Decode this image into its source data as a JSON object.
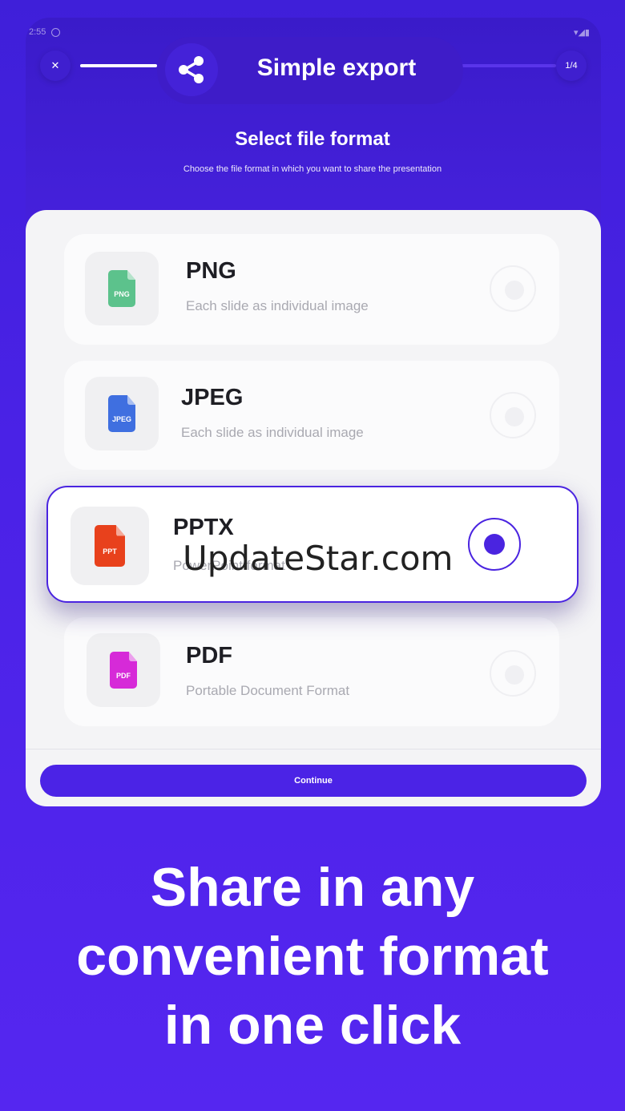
{
  "status_bar": {
    "time": "2:55"
  },
  "header": {
    "title": "Simple export",
    "step": "1/4",
    "close_symbol": "✕"
  },
  "section": {
    "title": "Select file format",
    "subtitle": "Choose the file format in which you want to share the presentation"
  },
  "options": [
    {
      "name": "PNG",
      "description": "Each slide as individual image",
      "icon_label": "PNG",
      "color": "#5cc28c",
      "selected": false
    },
    {
      "name": "JPEG",
      "description": "Each slide as individual image",
      "icon_label": "JPEG",
      "color": "#3f6fe0",
      "selected": false
    },
    {
      "name": "PPTX",
      "description": "PowerPoint format",
      "icon_label": "PPT",
      "color": "#e8411c",
      "selected": true
    },
    {
      "name": "PDF",
      "description": "Portable Document Format",
      "icon_label": "PDF",
      "color": "#d62ad8",
      "selected": false
    }
  ],
  "watermark": "UpdateStar.com",
  "continue_label": "Continue",
  "tagline": [
    "Share in any",
    "convenient format",
    "in one click"
  ],
  "colors": {
    "accent": "#4b23e6",
    "background": "#4a22e6"
  },
  "icons": {
    "close": "close-icon",
    "share": "share-icon",
    "file": "file-icon",
    "radio": "radio-icon"
  }
}
